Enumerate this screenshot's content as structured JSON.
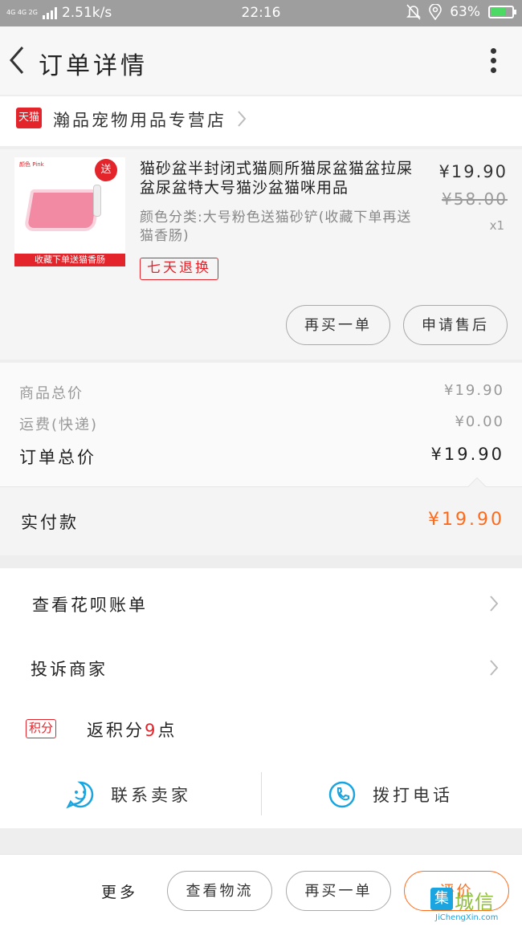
{
  "status_bar": {
    "network": "4G 4G 2G",
    "speed": "2.51k/s",
    "time": "22:16",
    "battery": "63%",
    "battery_level": 0.63
  },
  "nav": {
    "title": "订单详情",
    "back_icon": "chevron-left-icon",
    "more_icon": "more-vertical-icon"
  },
  "store": {
    "badge": "天猫",
    "name": "瀚品宠物用品专营店"
  },
  "product": {
    "title": "猫砂盆半封闭式猫厕所猫尿盆猫盆拉屎盆尿盆特大号猫沙盆猫咪用品",
    "spec": "颜色分类:大号粉色送猫砂铲(收藏下单再送猫香肠)",
    "price": "¥19.90",
    "original_price": "¥58.00",
    "quantity": "x1",
    "image_gift_label": "送",
    "image_caption": "收藏下单送猫香肠",
    "image_variant": "颜色 Pink",
    "return_badge": "七天退换",
    "buy_again_button": "再买一单",
    "after_sale_button": "申请售后"
  },
  "summary": {
    "goods_total_label": "商品总价",
    "goods_total_value": "¥19.90",
    "shipping_label": "运费(快递)",
    "shipping_value": "¥0.00",
    "order_total_label": "订单总价",
    "order_total_value": "¥19.90",
    "paid_label": "实付款",
    "paid_value": "¥19.90",
    "paid_color": "#ff6a1a"
  },
  "links": {
    "huabei": "查看花呗账单",
    "complain": "投诉商家",
    "points_badge": "积分",
    "points_prefix": "返积分",
    "points_count": "9",
    "points_suffix": "点",
    "contact_seller": "联系卖家",
    "call_phone": "拨打电话"
  },
  "bottom_bar": {
    "more": "更多",
    "logistics": "查看物流",
    "buy_again": "再买一单",
    "review": "评价"
  },
  "watermark": {
    "logo": "集",
    "cn": "城信",
    "en": "JiChengXin.com"
  }
}
